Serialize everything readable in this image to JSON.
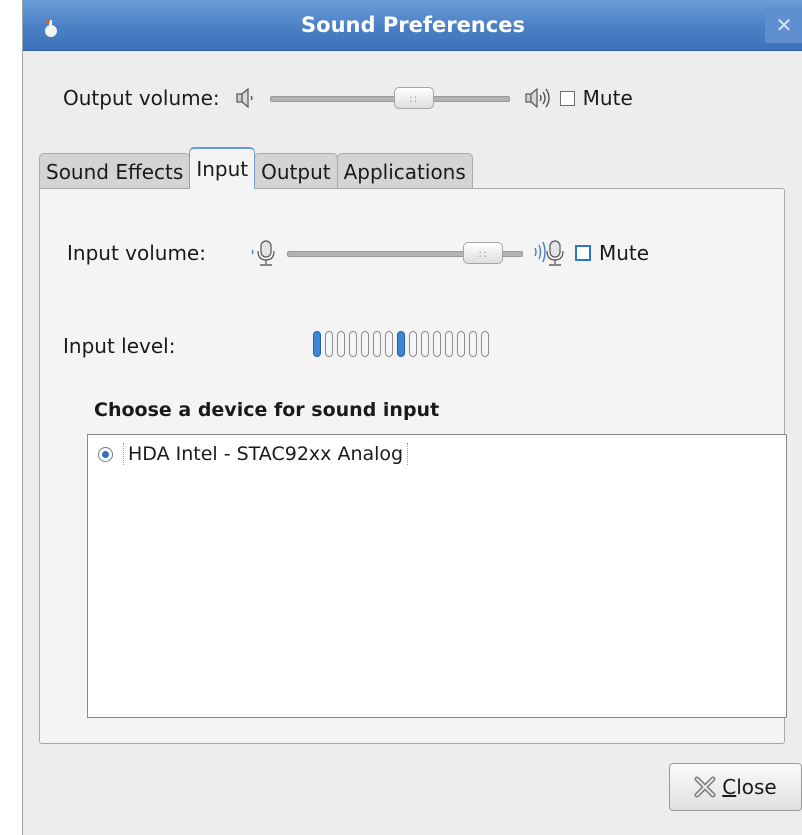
{
  "window": {
    "title": "Sound Preferences"
  },
  "output_volume": {
    "label": "Output volume:",
    "level": 0.62,
    "mute_label": "Mute",
    "muted": false
  },
  "tabs": [
    {
      "label": "Sound Effects",
      "active": false
    },
    {
      "label": "Input",
      "active": true
    },
    {
      "label": "Output",
      "active": false
    },
    {
      "label": "Applications",
      "active": false
    }
  ],
  "input": {
    "volume_label": "Input volume:",
    "volume_level": 0.9,
    "mute_label": "Mute",
    "muted": false,
    "level_label": "Input level:",
    "level_segments_total": 15,
    "level_segments_active": [
      0,
      7
    ],
    "device_heading": "Choose a device for sound input",
    "devices": [
      {
        "label": "HDA Intel - STAC92xx Analog",
        "selected": true
      }
    ]
  },
  "footer": {
    "close_label": "Close",
    "close_mnemonic": "C"
  },
  "colors": {
    "titlebar": "#4a80c4",
    "accent": "#3f86d6"
  },
  "icons": [
    "speaker-low-icon",
    "speaker-high-icon",
    "microphone-low-icon",
    "microphone-high-icon",
    "close-x-icon"
  ]
}
